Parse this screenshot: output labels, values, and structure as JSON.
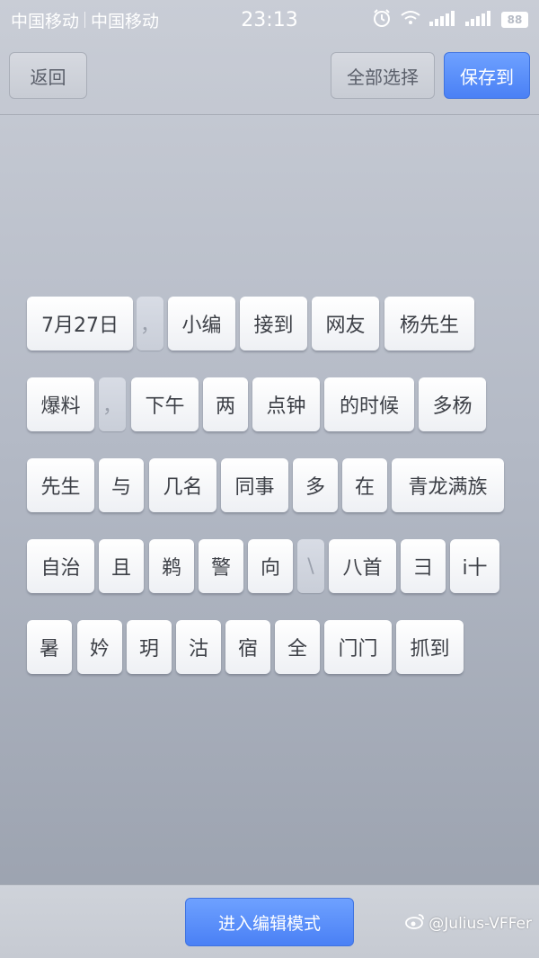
{
  "status_bar": {
    "carrier1": "中国移动",
    "carrier2": "中国移动",
    "time": "23:13",
    "battery": "88"
  },
  "toolbar": {
    "back_label": "返回",
    "select_all_label": "全部选择",
    "save_label": "保存到"
  },
  "tokens": [
    {
      "text": "7月27日",
      "selected": false
    },
    {
      "text": "，",
      "selected": true
    },
    {
      "text": "小编",
      "selected": false
    },
    {
      "text": "接到",
      "selected": false
    },
    {
      "text": "网友",
      "selected": false
    },
    {
      "text": "杨先生",
      "selected": false
    },
    {
      "text": "爆料",
      "selected": false
    },
    {
      "text": "，",
      "selected": true
    },
    {
      "text": "下午",
      "selected": false
    },
    {
      "text": "两",
      "selected": false
    },
    {
      "text": "点钟",
      "selected": false
    },
    {
      "text": "的时候",
      "selected": false
    },
    {
      "text": "多杨",
      "selected": false
    },
    {
      "text": "先生",
      "selected": false
    },
    {
      "text": "与",
      "selected": false
    },
    {
      "text": "几名",
      "selected": false
    },
    {
      "text": "同事",
      "selected": false
    },
    {
      "text": "多",
      "selected": false
    },
    {
      "text": "在",
      "selected": false
    },
    {
      "text": "青龙满族",
      "selected": false
    },
    {
      "text": "自治",
      "selected": false
    },
    {
      "text": "且",
      "selected": false
    },
    {
      "text": "鹈",
      "selected": false
    },
    {
      "text": "警",
      "selected": false
    },
    {
      "text": "向",
      "selected": false
    },
    {
      "text": "\\",
      "selected": true
    },
    {
      "text": "八首",
      "selected": false
    },
    {
      "text": "彐",
      "selected": false
    },
    {
      "text": "i十",
      "selected": false
    },
    {
      "text": "暑",
      "selected": false
    },
    {
      "text": "妗",
      "selected": false
    },
    {
      "text": "玥",
      "selected": false
    },
    {
      "text": "沽",
      "selected": false
    },
    {
      "text": "宿",
      "selected": false
    },
    {
      "text": "全",
      "selected": false
    },
    {
      "text": "门门",
      "selected": false
    },
    {
      "text": "抓到",
      "selected": false
    }
  ],
  "bottom": {
    "edit_mode_label": "进入编辑模式"
  },
  "watermark": {
    "text": "@Julius-VFFer",
    "icon": "weibo-icon"
  },
  "colors": {
    "accent": "#4a80f5",
    "status_text": "#ffffff"
  }
}
